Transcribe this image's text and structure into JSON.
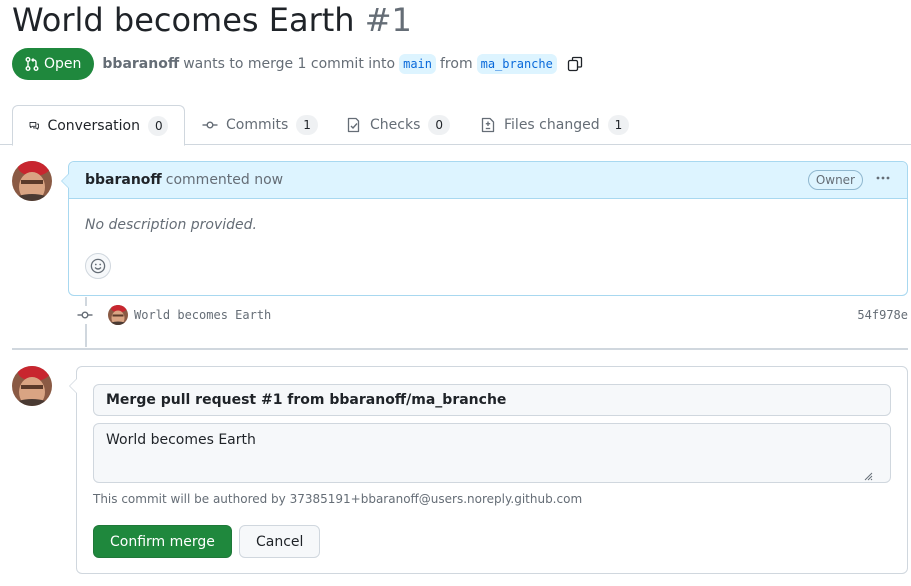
{
  "pr": {
    "title": "World becomes Earth",
    "number": "#1",
    "state": "Open",
    "author": "bbaranoff",
    "merge_text": "wants to merge 1 commit into",
    "base_branch": "main",
    "from_text": "from",
    "head_branch": "ma_branche"
  },
  "tabs": [
    {
      "label": "Conversation",
      "count": "0"
    },
    {
      "label": "Commits",
      "count": "1"
    },
    {
      "label": "Checks",
      "count": "0"
    },
    {
      "label": "Files changed",
      "count": "1"
    }
  ],
  "comment": {
    "author": "bbaranoff",
    "action": "commented now",
    "role": "Owner",
    "body": "No description provided."
  },
  "commit": {
    "message": "World becomes Earth",
    "sha": "54f978e"
  },
  "merge": {
    "title_value": "Merge pull request #1 from bbaranoff/ma_branche",
    "description_value": "World becomes Earth",
    "author_note": "This commit will be authored by 37385191+bbaranoff@users.noreply.github.com",
    "confirm_label": "Confirm merge",
    "cancel_label": "Cancel"
  },
  "colors": {
    "open_green": "#1f883d",
    "link_blue": "#0969da",
    "comment_header_bg": "#ddf4ff"
  }
}
